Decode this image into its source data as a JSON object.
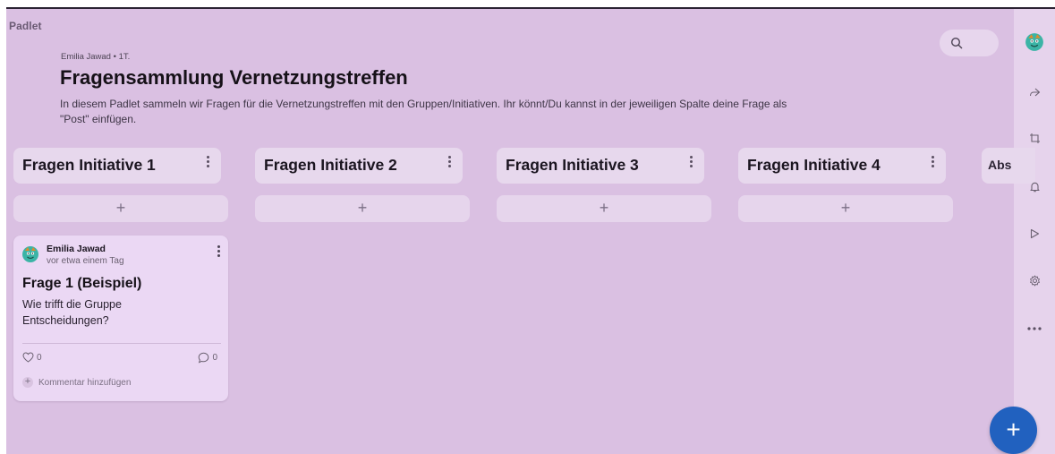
{
  "app": {
    "logo_text": "Padlet"
  },
  "header": {
    "meta": "Emilia Jawad • 1T.",
    "title": "Fragensammlung Vernetzungstreffen",
    "description_line1": "In diesem Padlet sammeln wir Fragen für die Vernetzungstreffen mit den Gruppen/Initiativen. Ihr könnt/Du kannst in der jeweiligen Spalte deine Frage als",
    "description_line2": "\"Post\" einfügen."
  },
  "search": {
    "icon": "search-icon"
  },
  "columns": [
    {
      "label": "Fragen Initiative 1",
      "add_label": "+"
    },
    {
      "label": "Fragen Initiative 2",
      "add_label": "+"
    },
    {
      "label": "Fragen Initiative 3",
      "add_label": "+"
    },
    {
      "label": "Fragen Initiative 4",
      "add_label": "+"
    },
    {
      "label": "Abs"
    }
  ],
  "post": {
    "author": "Emilia Jawad",
    "time": "vor etwa einem Tag",
    "title": "Frage 1 (Beispiel)",
    "body": "Wie trifft die Gruppe Entscheidungen?",
    "likes": "0",
    "comments": "0",
    "add_comment": "Kommentar hinzufügen"
  },
  "right_rail": [
    {
      "icon": "avatar-icon"
    },
    {
      "icon": "share-icon"
    },
    {
      "icon": "remake-icon"
    },
    {
      "icon": "bell-icon"
    },
    {
      "icon": "play-icon"
    },
    {
      "icon": "gear-icon"
    },
    {
      "icon": "more-icon"
    }
  ],
  "fab": {
    "label": "+"
  },
  "colors": {
    "background": "#dac0e2",
    "column_header": "#e7d8ed",
    "card": "#ebd8f4",
    "fab": "#2161bf"
  }
}
